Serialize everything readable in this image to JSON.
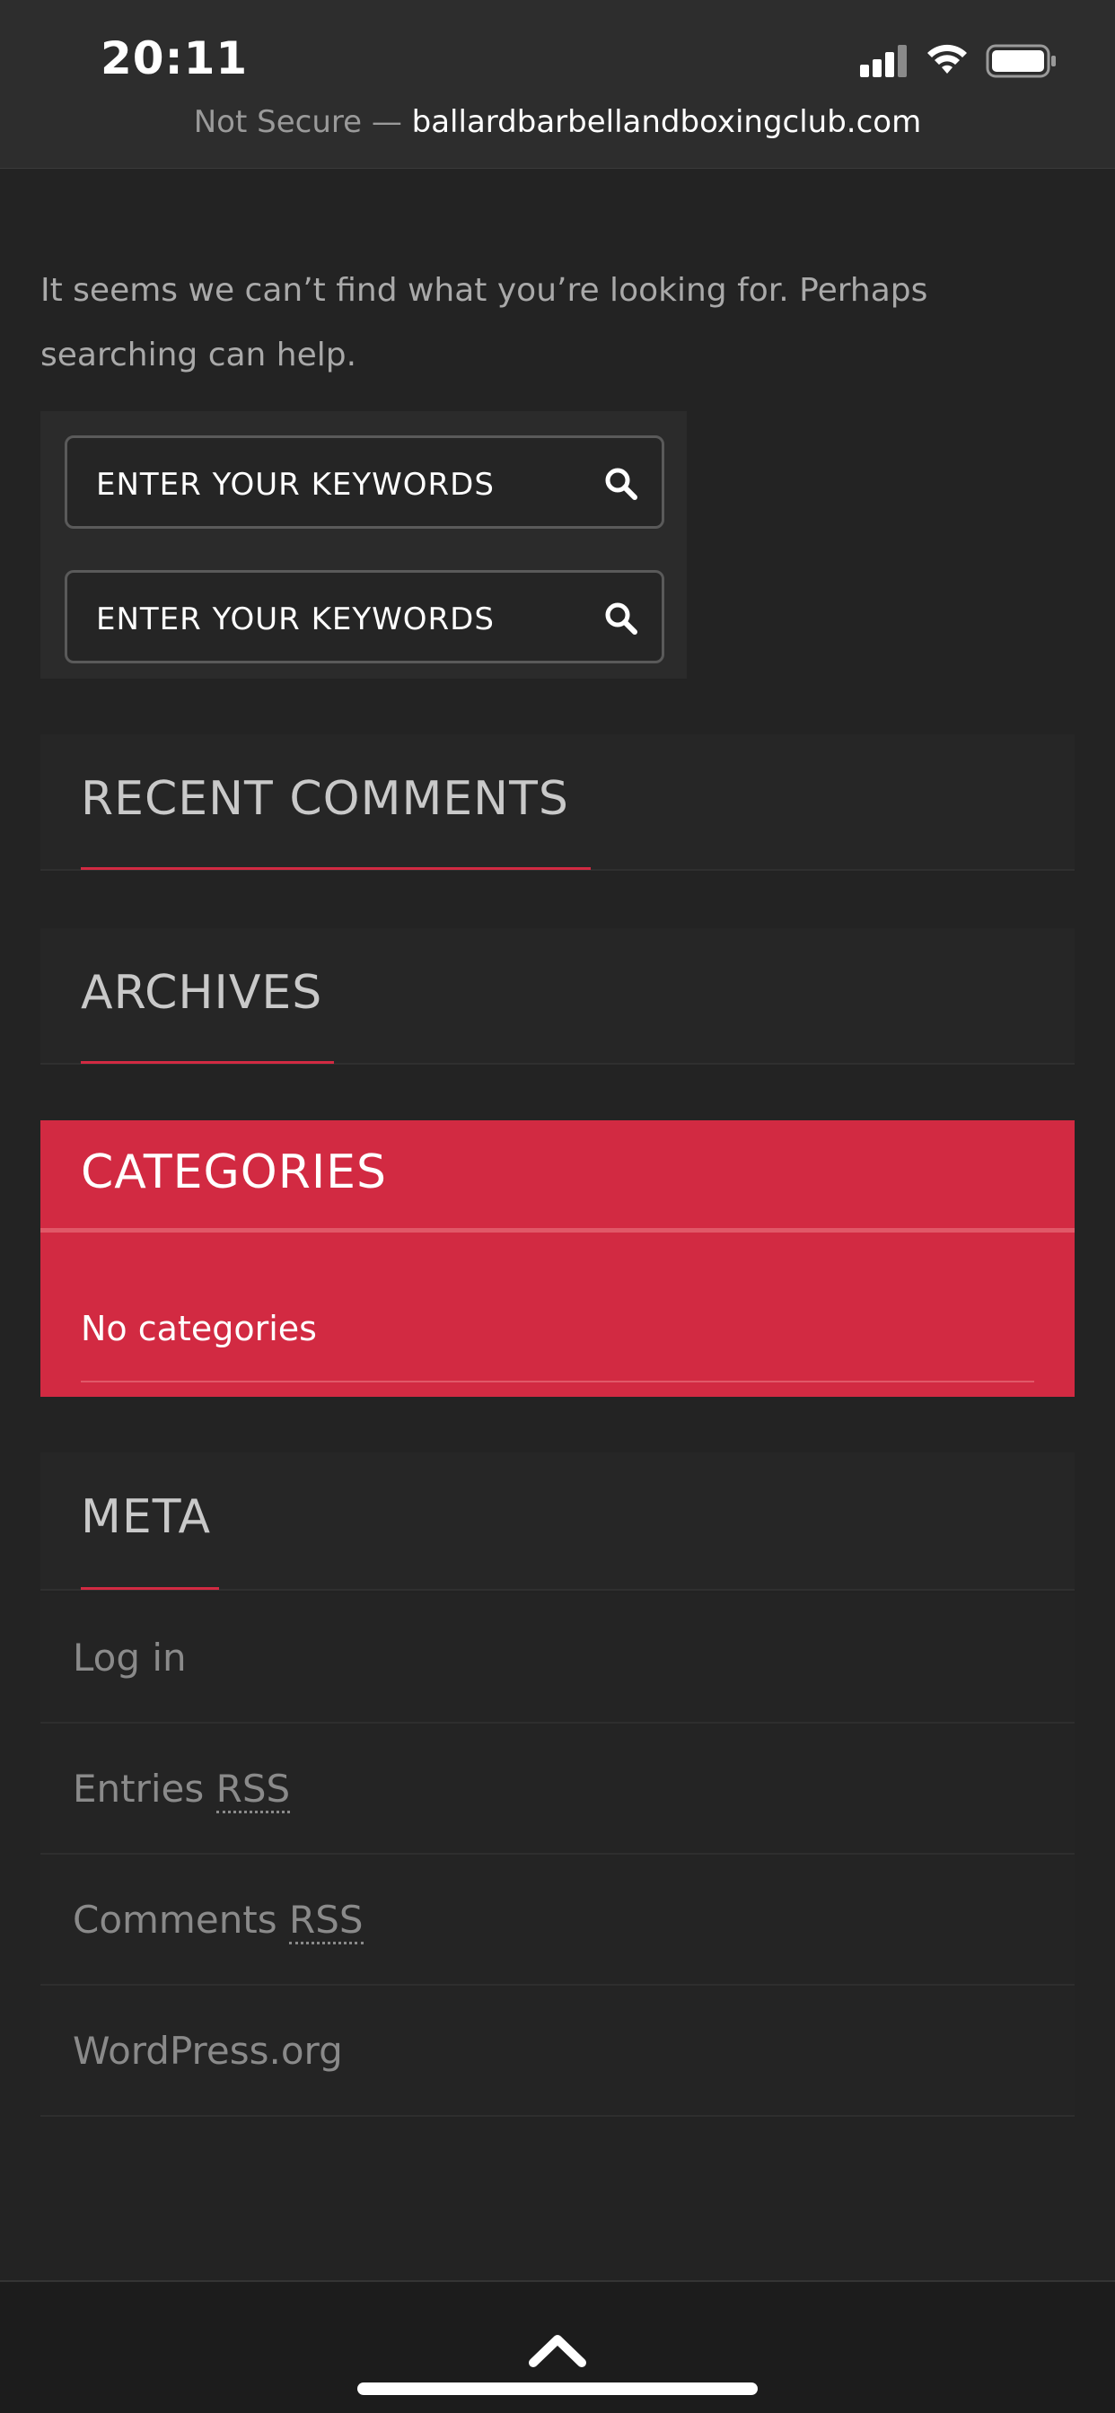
{
  "status_bar": {
    "time": "20:11"
  },
  "url_bar": {
    "security": "Not Secure —",
    "domain": "ballardbarbellandboxingclub.com"
  },
  "intro_text": "It seems we can’t find what you’re looking for. Perhaps searching can help.",
  "search": {
    "placeholder_1": "ENTER YOUR KEYWORDS",
    "placeholder_2": "ENTER YOUR KEYWORDS"
  },
  "widgets": {
    "recent_comments": "RECENT COMMENTS",
    "archives": "ARCHIVES",
    "categories": {
      "title": "CATEGORIES",
      "item": "No categories"
    },
    "meta": {
      "title": "META",
      "links": [
        {
          "text": "Log in",
          "suffix": ""
        },
        {
          "text": "Entries ",
          "suffix": "RSS"
        },
        {
          "text": "Comments ",
          "suffix": "RSS"
        },
        {
          "text": "WordPress.org",
          "suffix": ""
        }
      ]
    }
  },
  "colors": {
    "accent": "#d22a42",
    "background": "#232323"
  },
  "icons": [
    "signal-icon",
    "wifi-icon",
    "battery-icon",
    "search-icon",
    "chevron-up-icon"
  ]
}
